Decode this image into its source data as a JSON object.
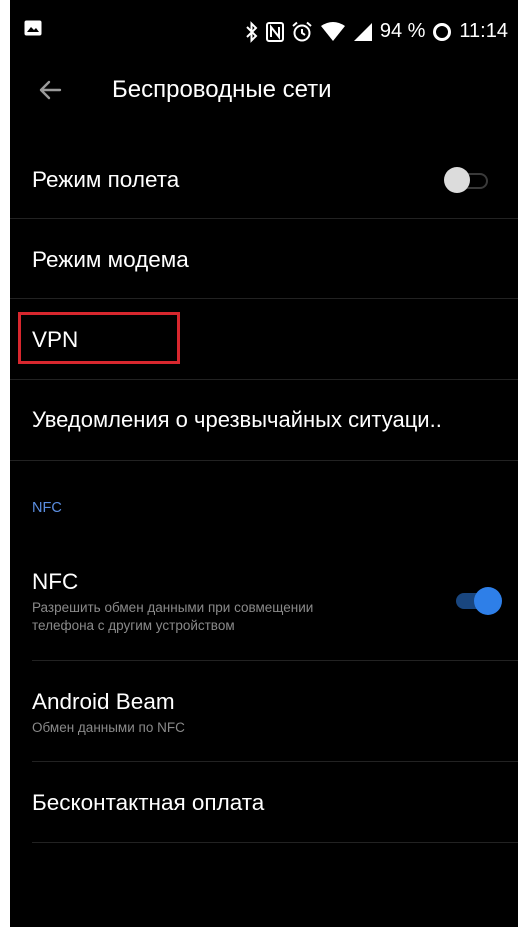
{
  "status_bar": {
    "battery": "94 %",
    "time": "11:14",
    "icons": [
      "image-icon",
      "bluetooth-icon",
      "nfc-icon",
      "alarm-icon",
      "wifi-icon",
      "cellular-icon",
      "battery-ring-icon"
    ]
  },
  "app_bar": {
    "title": "Беспроводные сети",
    "back_icon": "arrow-left-icon"
  },
  "items": {
    "airplane": {
      "label": "Режим полета",
      "toggle_on": false
    },
    "modem": {
      "label": "Режим модема"
    },
    "vpn": {
      "label": "VPN"
    },
    "emergency": {
      "label": "Уведомления о чрезвычайных ситуаци.."
    },
    "nfc_section": {
      "header": "NFC"
    },
    "nfc": {
      "label": "NFC",
      "summary_line1": "Разрешить обмен данными при совмещении",
      "summary_line2": "телефона с другим устройством",
      "toggle_on": true
    },
    "beam": {
      "label": "Android Beam",
      "summary": "Обмен данными по NFC"
    },
    "payment": {
      "label": "Бесконтактная оплата"
    }
  },
  "colors": {
    "background": "#000000",
    "accent": "#2e7fe8",
    "section_header": "#5b8ee0",
    "highlight_border": "#d7272e"
  }
}
